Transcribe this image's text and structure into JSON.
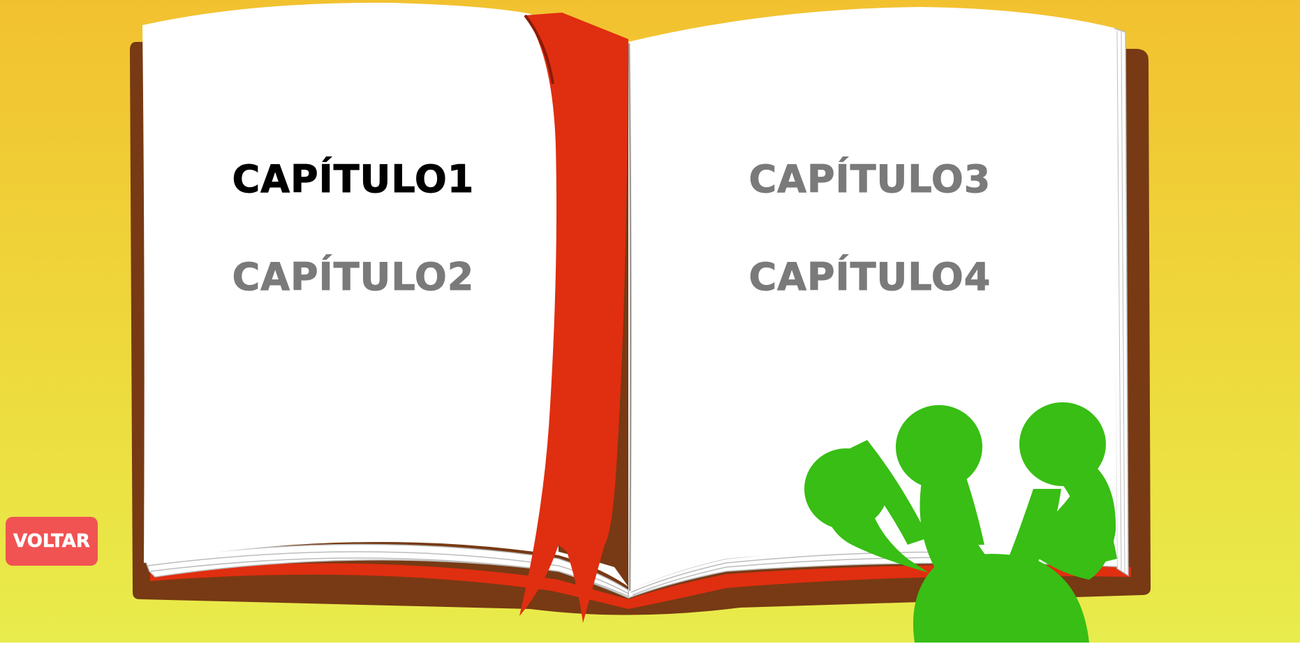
{
  "book": {
    "chapters": [
      {
        "label": "CAPÍTULO1",
        "state": "unlocked"
      },
      {
        "label": "CAPÍTULO2",
        "state": "locked"
      },
      {
        "label": "CAPÍTULO3",
        "state": "locked"
      },
      {
        "label": "CAPÍTULO4",
        "state": "locked"
      }
    ]
  },
  "back_button": {
    "label": "VOLTAR"
  },
  "icons": {
    "bookmark": "red-bookmark-ribbon",
    "mascot": "green-alien-hand"
  },
  "colors": {
    "background_top": "#f2c130",
    "background_bottom": "#e8ec4c",
    "book_cover": "#773a14",
    "bookmark": "#e02e10",
    "mascot": "#38be14",
    "chapter_active": "#000000",
    "chapter_locked": "#7a7a7a",
    "back_button": "#f15353"
  }
}
